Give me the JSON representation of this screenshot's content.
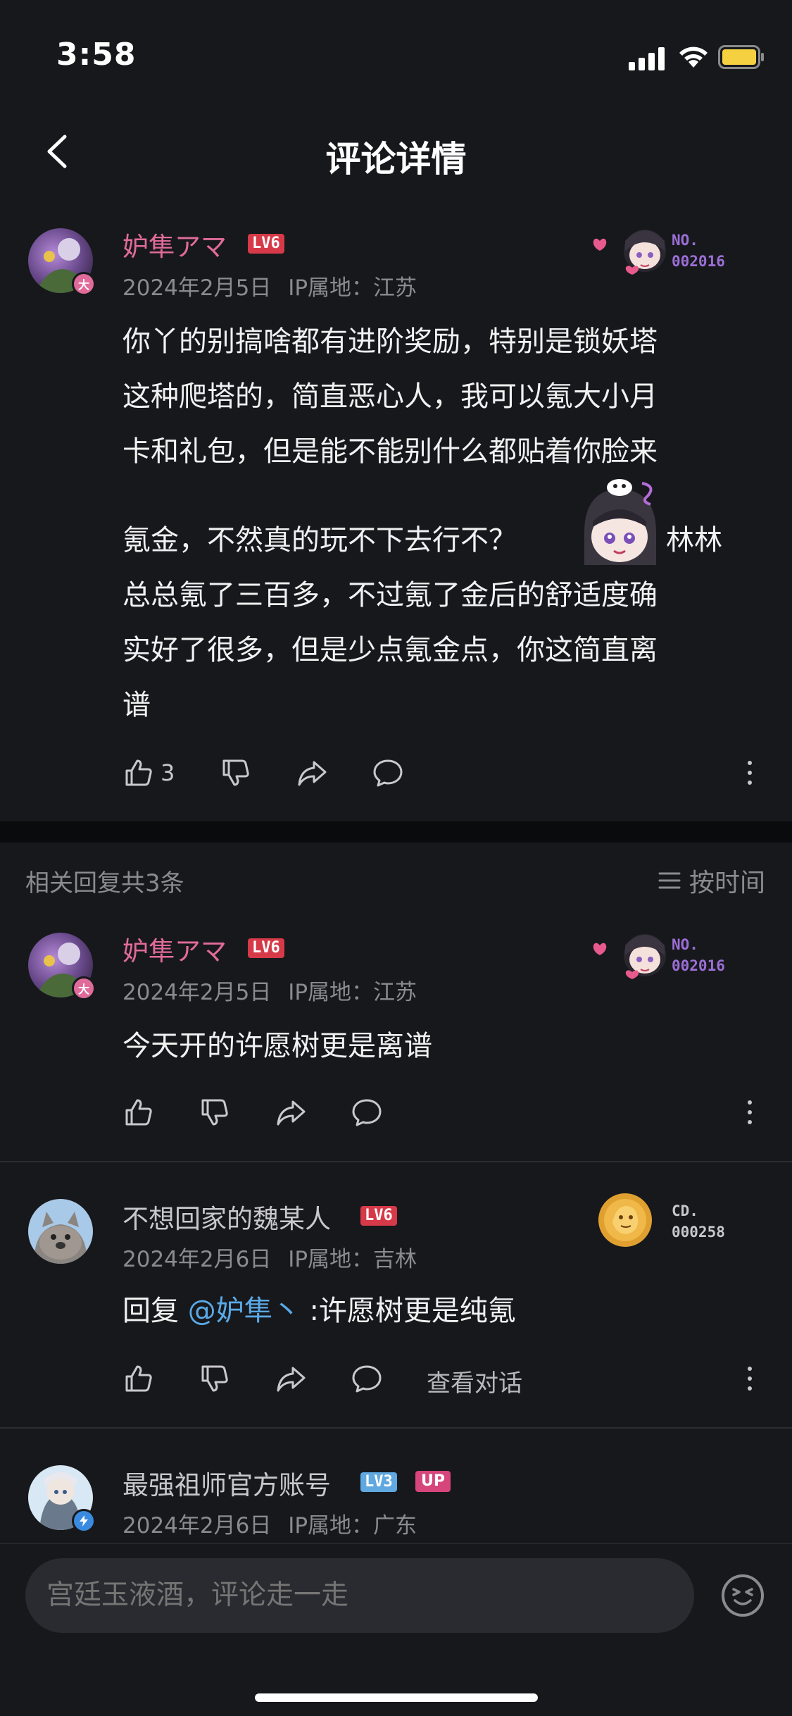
{
  "status_bar": {
    "time": "3:58"
  },
  "nav": {
    "title": "评论详情"
  },
  "main_comment": {
    "username": "妒隼アマ",
    "level": "LV6",
    "avatar_badge": "大",
    "date": "2024年2月5日",
    "ip": "IP属地：江苏",
    "medal_label": "NO.",
    "medal_number": "002016",
    "text_line1": "你丫的别搞啥都有进阶奖励，特别是锁妖塔",
    "text_line2": "这种爬塔的，简直恶心人，我可以氪大小月",
    "text_line3": "卡和礼包，但是能不能别什么都贴着你脸来",
    "text_line4a": "氪金，不然真的玩不下去行不？",
    "text_line4b": "林林",
    "text_line5": "总总氪了三百多，不过氪了金后的舒适度确",
    "text_line6": "实好了很多，但是少点氪金点，你这简直离",
    "text_line7": "谱",
    "like_count": "3"
  },
  "replies_header": {
    "count_text": "相关回复共3条",
    "sort_label": "按时间"
  },
  "replies": [
    {
      "username": "妒隼アマ",
      "level": "LV6",
      "avatar_badge": "大",
      "date": "2024年2月5日",
      "ip": "IP属地：江苏",
      "medal_label": "NO.",
      "medal_number": "002016",
      "text": "今天开的许愿树更是离谱"
    },
    {
      "username": "不想回家的魏某人",
      "level": "LV6",
      "date": "2024年2月6日",
      "ip": "IP属地：吉林",
      "medal_label": "CD.",
      "medal_number": "000258",
      "reply_prefix": "回复",
      "mention": "@妒隼丶",
      "text": ":许愿树更是纯氪",
      "view_conversation": "查看对话"
    },
    {
      "username": "最强祖师官方账号",
      "level": "LV3",
      "up_tag": "UP",
      "date": "2024年2月6日",
      "ip": "IP属地：广东"
    }
  ],
  "bottom_bar": {
    "input_placeholder": "宫廷玉液酒，评论走一走"
  },
  "colors": {
    "background": "#17181c",
    "username_pink": "#e06b9a",
    "level_red": "#d63a48",
    "level_blue": "#5fa8e0",
    "medal_purple": "#9b6fd6",
    "medal_gray": "#c8c8cc",
    "mention_blue": "#5aa9e6"
  }
}
